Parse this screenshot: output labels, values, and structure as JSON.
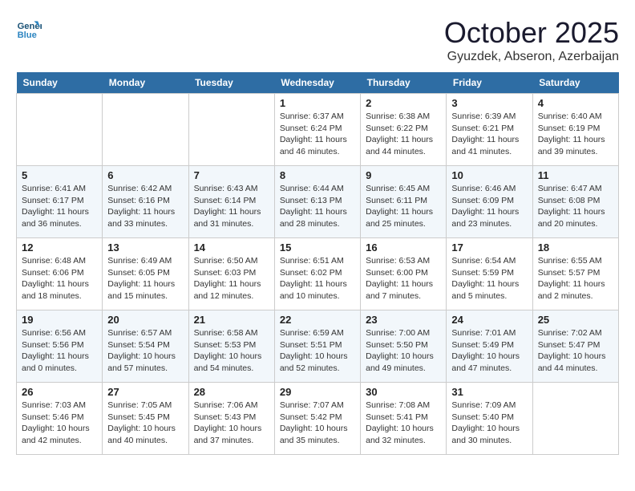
{
  "logo": {
    "line1": "General",
    "line2": "Blue"
  },
  "title": "October 2025",
  "subtitle": "Gyuzdek, Abseron, Azerbaijan",
  "weekdays": [
    "Sunday",
    "Monday",
    "Tuesday",
    "Wednesday",
    "Thursday",
    "Friday",
    "Saturday"
  ],
  "weeks": [
    [
      {
        "day": "",
        "info": ""
      },
      {
        "day": "",
        "info": ""
      },
      {
        "day": "",
        "info": ""
      },
      {
        "day": "1",
        "info": "Sunrise: 6:37 AM\nSunset: 6:24 PM\nDaylight: 11 hours\nand 46 minutes."
      },
      {
        "day": "2",
        "info": "Sunrise: 6:38 AM\nSunset: 6:22 PM\nDaylight: 11 hours\nand 44 minutes."
      },
      {
        "day": "3",
        "info": "Sunrise: 6:39 AM\nSunset: 6:21 PM\nDaylight: 11 hours\nand 41 minutes."
      },
      {
        "day": "4",
        "info": "Sunrise: 6:40 AM\nSunset: 6:19 PM\nDaylight: 11 hours\nand 39 minutes."
      }
    ],
    [
      {
        "day": "5",
        "info": "Sunrise: 6:41 AM\nSunset: 6:17 PM\nDaylight: 11 hours\nand 36 minutes."
      },
      {
        "day": "6",
        "info": "Sunrise: 6:42 AM\nSunset: 6:16 PM\nDaylight: 11 hours\nand 33 minutes."
      },
      {
        "day": "7",
        "info": "Sunrise: 6:43 AM\nSunset: 6:14 PM\nDaylight: 11 hours\nand 31 minutes."
      },
      {
        "day": "8",
        "info": "Sunrise: 6:44 AM\nSunset: 6:13 PM\nDaylight: 11 hours\nand 28 minutes."
      },
      {
        "day": "9",
        "info": "Sunrise: 6:45 AM\nSunset: 6:11 PM\nDaylight: 11 hours\nand 25 minutes."
      },
      {
        "day": "10",
        "info": "Sunrise: 6:46 AM\nSunset: 6:09 PM\nDaylight: 11 hours\nand 23 minutes."
      },
      {
        "day": "11",
        "info": "Sunrise: 6:47 AM\nSunset: 6:08 PM\nDaylight: 11 hours\nand 20 minutes."
      }
    ],
    [
      {
        "day": "12",
        "info": "Sunrise: 6:48 AM\nSunset: 6:06 PM\nDaylight: 11 hours\nand 18 minutes."
      },
      {
        "day": "13",
        "info": "Sunrise: 6:49 AM\nSunset: 6:05 PM\nDaylight: 11 hours\nand 15 minutes."
      },
      {
        "day": "14",
        "info": "Sunrise: 6:50 AM\nSunset: 6:03 PM\nDaylight: 11 hours\nand 12 minutes."
      },
      {
        "day": "15",
        "info": "Sunrise: 6:51 AM\nSunset: 6:02 PM\nDaylight: 11 hours\nand 10 minutes."
      },
      {
        "day": "16",
        "info": "Sunrise: 6:53 AM\nSunset: 6:00 PM\nDaylight: 11 hours\nand 7 minutes."
      },
      {
        "day": "17",
        "info": "Sunrise: 6:54 AM\nSunset: 5:59 PM\nDaylight: 11 hours\nand 5 minutes."
      },
      {
        "day": "18",
        "info": "Sunrise: 6:55 AM\nSunset: 5:57 PM\nDaylight: 11 hours\nand 2 minutes."
      }
    ],
    [
      {
        "day": "19",
        "info": "Sunrise: 6:56 AM\nSunset: 5:56 PM\nDaylight: 11 hours\nand 0 minutes."
      },
      {
        "day": "20",
        "info": "Sunrise: 6:57 AM\nSunset: 5:54 PM\nDaylight: 10 hours\nand 57 minutes."
      },
      {
        "day": "21",
        "info": "Sunrise: 6:58 AM\nSunset: 5:53 PM\nDaylight: 10 hours\nand 54 minutes."
      },
      {
        "day": "22",
        "info": "Sunrise: 6:59 AM\nSunset: 5:51 PM\nDaylight: 10 hours\nand 52 minutes."
      },
      {
        "day": "23",
        "info": "Sunrise: 7:00 AM\nSunset: 5:50 PM\nDaylight: 10 hours\nand 49 minutes."
      },
      {
        "day": "24",
        "info": "Sunrise: 7:01 AM\nSunset: 5:49 PM\nDaylight: 10 hours\nand 47 minutes."
      },
      {
        "day": "25",
        "info": "Sunrise: 7:02 AM\nSunset: 5:47 PM\nDaylight: 10 hours\nand 44 minutes."
      }
    ],
    [
      {
        "day": "26",
        "info": "Sunrise: 7:03 AM\nSunset: 5:46 PM\nDaylight: 10 hours\nand 42 minutes."
      },
      {
        "day": "27",
        "info": "Sunrise: 7:05 AM\nSunset: 5:45 PM\nDaylight: 10 hours\nand 40 minutes."
      },
      {
        "day": "28",
        "info": "Sunrise: 7:06 AM\nSunset: 5:43 PM\nDaylight: 10 hours\nand 37 minutes."
      },
      {
        "day": "29",
        "info": "Sunrise: 7:07 AM\nSunset: 5:42 PM\nDaylight: 10 hours\nand 35 minutes."
      },
      {
        "day": "30",
        "info": "Sunrise: 7:08 AM\nSunset: 5:41 PM\nDaylight: 10 hours\nand 32 minutes."
      },
      {
        "day": "31",
        "info": "Sunrise: 7:09 AM\nSunset: 5:40 PM\nDaylight: 10 hours\nand 30 minutes."
      },
      {
        "day": "",
        "info": ""
      }
    ]
  ]
}
